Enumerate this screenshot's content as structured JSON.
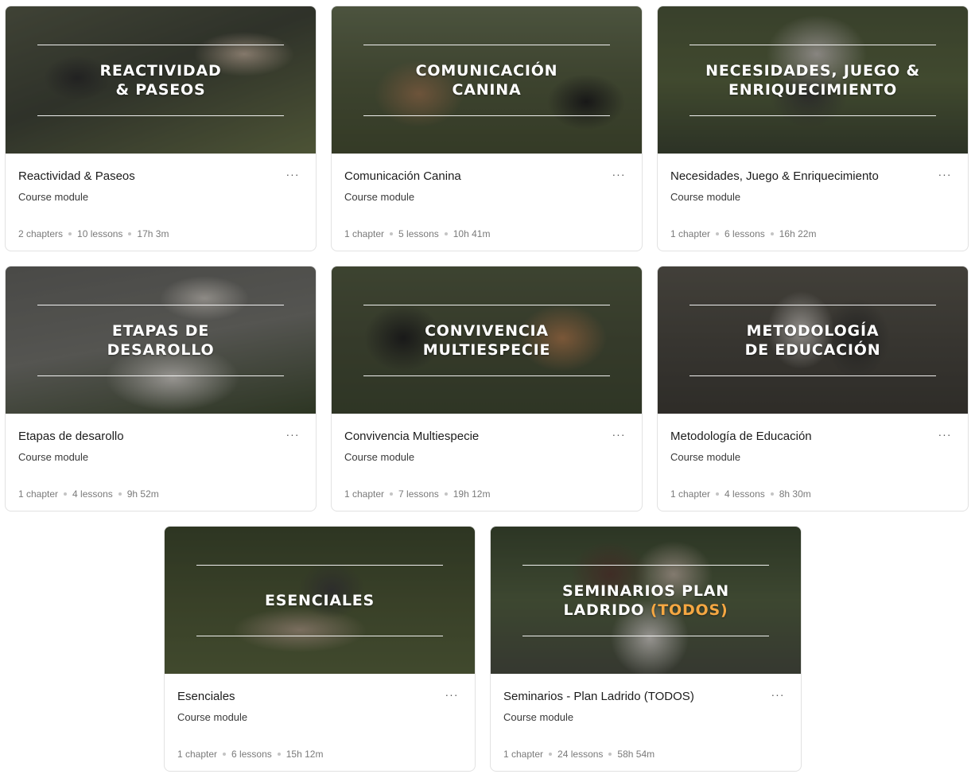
{
  "cards": [
    {
      "thumb_lines": [
        "REACTIVIDAD",
        "& PASEOS"
      ],
      "title": "Reactividad & Paseos",
      "subtitle": "Course module",
      "chapters": "2 chapters",
      "lessons": "10 lessons",
      "duration": "17h 3m",
      "more_label": "···"
    },
    {
      "thumb_lines": [
        "COMUNICACIÓN",
        "CANINA"
      ],
      "title": "Comunicación Canina",
      "subtitle": "Course module",
      "chapters": "1 chapter",
      "lessons": "5 lessons",
      "duration": "10h 41m",
      "more_label": "···"
    },
    {
      "thumb_lines": [
        "NECESIDADES, JUEGO &",
        "ENRIQUECIMIENTO"
      ],
      "title": "Necesidades, Juego & Enriquecimiento",
      "subtitle": "Course module",
      "chapters": "1 chapter",
      "lessons": "6 lessons",
      "duration": "16h 22m",
      "more_label": "···"
    },
    {
      "thumb_lines": [
        "ETAPAS DE",
        "DESAROLLO"
      ],
      "title": "Etapas de desarollo",
      "subtitle": "Course module",
      "chapters": "1 chapter",
      "lessons": "4 lessons",
      "duration": "9h 52m",
      "more_label": "···"
    },
    {
      "thumb_lines": [
        "CONVIVENCIA",
        "MULTIESPECIE"
      ],
      "title": "Convivencia Multiespecie",
      "subtitle": "Course module",
      "chapters": "1 chapter",
      "lessons": "7 lessons",
      "duration": "19h 12m",
      "more_label": "···"
    },
    {
      "thumb_lines": [
        "METODOLOGÍA",
        "DE EDUCACIÓN"
      ],
      "title": "Metodología de Educación",
      "subtitle": "Course module",
      "chapters": "1 chapter",
      "lessons": "4 lessons",
      "duration": "8h 30m",
      "more_label": "···"
    },
    {
      "thumb_lines": [
        "ESENCIALES"
      ],
      "title": "Esenciales",
      "subtitle": "Course module",
      "chapters": "1 chapter",
      "lessons": "6 lessons",
      "duration": "15h 12m",
      "more_label": "···"
    },
    {
      "thumb_lines": [
        "SEMINARIOS PLAN",
        "LADRIDO"
      ],
      "thumb_accent": "(TODOS)",
      "title": "Seminarios - Plan Ladrido (TODOS)",
      "subtitle": "Course module",
      "chapters": "1 chapter",
      "lessons": "24 lessons",
      "duration": "58h 54m",
      "more_label": "···"
    }
  ],
  "colors": {
    "accent": "#f5a742",
    "card_border": "#e2e2e2",
    "meta_text": "#7a7a7a"
  },
  "icons": {
    "more": "more-horizontal-icon"
  }
}
